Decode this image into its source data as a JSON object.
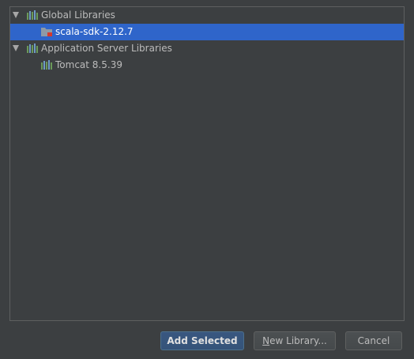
{
  "tree": {
    "groups": [
      {
        "label": "Global Libraries",
        "expanded": true,
        "icon": "library-icon",
        "children": [
          {
            "label": "scala-sdk-2.12.7",
            "icon": "scala-sdk-folder-icon",
            "selected": true
          }
        ]
      },
      {
        "label": "Application Server Libraries",
        "expanded": true,
        "icon": "library-icon",
        "children": [
          {
            "label": "Tomcat 8.5.39",
            "icon": "library-icon",
            "selected": false
          }
        ]
      }
    ]
  },
  "buttons": {
    "add_selected": "Add Selected",
    "new_library_mnemonic": "N",
    "new_library_rest": "ew Library...",
    "cancel": "Cancel"
  },
  "colors": {
    "background": "#3c3f41",
    "selection": "#2f65ca",
    "library_icon_green": "#6a9a5a",
    "library_icon_blue": "#6f9bc7",
    "primary_button": "#365880"
  }
}
